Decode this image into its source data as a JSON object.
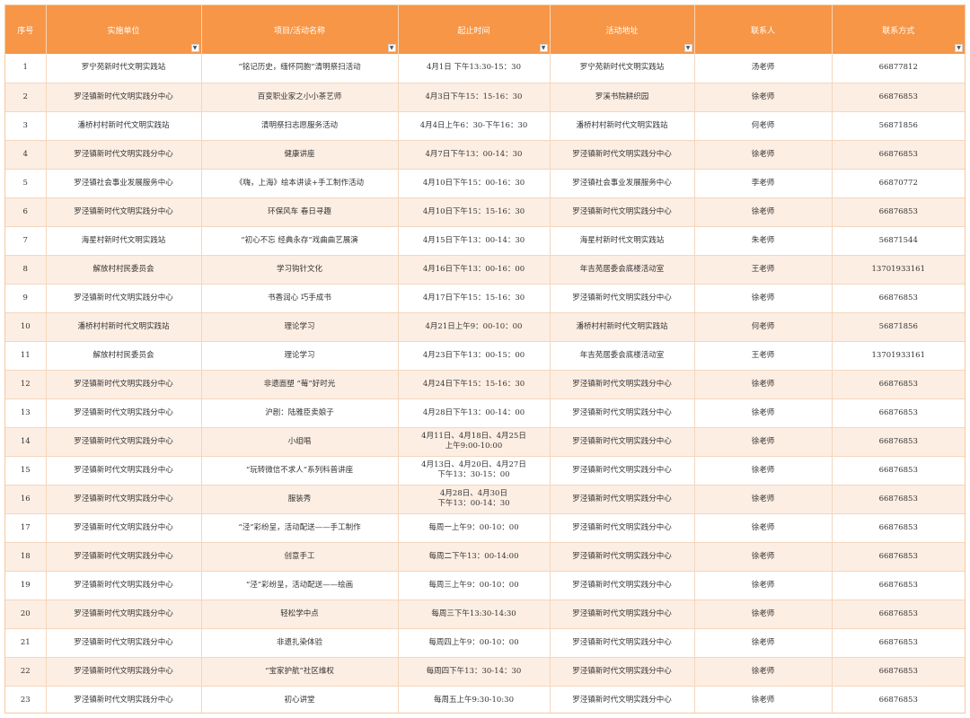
{
  "headers": [
    {
      "key": "no",
      "label": "序号"
    },
    {
      "key": "unit",
      "label": "实施单位"
    },
    {
      "key": "name",
      "label": "项目/活动名称"
    },
    {
      "key": "time",
      "label": "起止时间"
    },
    {
      "key": "place",
      "label": "活动地址"
    },
    {
      "key": "contact",
      "label": "联系人"
    },
    {
      "key": "phone",
      "label": "联系方式"
    }
  ],
  "filter_icon": "dropdown-arrow-icon",
  "colors": {
    "header_bg": "#f79646",
    "header_text": "#ffffff",
    "row_alt_bg": "#fdeee3",
    "row_bg": "#ffffff",
    "border": "#f4d6bd"
  },
  "rows": [
    {
      "no": "1",
      "unit": "罗宁苑新时代文明实践站",
      "name": "“铭记历史，缅怀同胞”清明祭扫活动",
      "time": "4月1日 下午13:30-15：30",
      "place": "罗宁苑新时代文明实践站",
      "contact": "汤老师",
      "phone": "66877812"
    },
    {
      "no": "2",
      "unit": "罗泾镇新时代文明实践分中心",
      "name": "百变职业家之小小茶艺师",
      "time": "4月3日下午15：15-16：30",
      "place": "罗溪书院耕织园",
      "contact": "徐老师",
      "phone": "66876853"
    },
    {
      "no": "3",
      "unit": "潘桥村村新时代文明实践站",
      "name": "清明祭扫志愿服务活动",
      "time": "4月4日上午6：30-下午16：30",
      "place": "潘桥村村新时代文明实践站",
      "contact": "何老师",
      "phone": "56871856"
    },
    {
      "no": "4",
      "unit": "罗泾镇新时代文明实践分中心",
      "name": "健康讲座",
      "time": "4月7日下午13：00-14：30",
      "place": "罗泾镇新时代文明实践分中心",
      "contact": "徐老师",
      "phone": "66876853"
    },
    {
      "no": "5",
      "unit": "罗泾镇社会事业发展服务中心",
      "name": "《嗨，上海》绘本讲读+手工制作活动",
      "time": "4月10日下午15：00-16：30",
      "place": "罗泾镇社会事业发展服务中心",
      "contact": "李老师",
      "phone": "66870772"
    },
    {
      "no": "6",
      "unit": "罗泾镇新时代文明实践分中心",
      "name": "环保风车 春日寻趣",
      "time": "4月10日下午15：15-16：30",
      "place": "罗泾镇新时代文明实践分中心",
      "contact": "徐老师",
      "phone": "66876853"
    },
    {
      "no": "7",
      "unit": "海星村新时代文明实践站",
      "name": "“初心不忘 经典永存”戏曲曲艺展演",
      "time": "4月15日下午13：00-14：30",
      "place": "海星村新时代文明实践站",
      "contact": "朱老师",
      "phone": "56871544"
    },
    {
      "no": "8",
      "unit": "解放村村民委员会",
      "name": "学习钩针文化",
      "time": "4月16日下午13：00-16：00",
      "place": "年吉苑居委会底楼活动室",
      "contact": "王老师",
      "phone": "13701933161"
    },
    {
      "no": "9",
      "unit": "罗泾镇新时代文明实践分中心",
      "name": "书香润心 巧手成书",
      "time": "4月17日下午15：15-16：30",
      "place": "罗泾镇新时代文明实践分中心",
      "contact": "徐老师",
      "phone": "66876853"
    },
    {
      "no": "10",
      "unit": "潘桥村村新时代文明实践站",
      "name": "理论学习",
      "time": "4月21日上午9：00-10：00",
      "place": "潘桥村村新时代文明实践站",
      "contact": "何老师",
      "phone": "56871856"
    },
    {
      "no": "11",
      "unit": "解放村村民委员会",
      "name": "理论学习",
      "time": "4月23日下午13：00-15：00",
      "place": "年吉苑居委会底楼活动室",
      "contact": "王老师",
      "phone": "13701933161"
    },
    {
      "no": "12",
      "unit": "罗泾镇新时代文明实践分中心",
      "name": "非遗面塑 “莓”好时光",
      "time": "4月24日下午15：15-16：30",
      "place": "罗泾镇新时代文明实践分中心",
      "contact": "徐老师",
      "phone": "66876853"
    },
    {
      "no": "13",
      "unit": "罗泾镇新时代文明实践分中心",
      "name": "沪剧：陆雅臣卖娘子",
      "time": "4月28日下午13：00-14：00",
      "place": "罗泾镇新时代文明实践分中心",
      "contact": "徐老师",
      "phone": "66876853"
    },
    {
      "no": "14",
      "unit": "罗泾镇新时代文明实践分中心",
      "name": "小组唱",
      "time": "4月11日、4月18日、4月25日\n上午9:00-10:00",
      "place": "罗泾镇新时代文明实践分中心",
      "contact": "徐老师",
      "phone": "66876853"
    },
    {
      "no": "15",
      "unit": "罗泾镇新时代文明实践分中心",
      "name": "“玩转微信不求人”系列科普讲座",
      "time": "4月13日、4月20日、4月27日\n下午13：30-15：00",
      "place": "罗泾镇新时代文明实践分中心",
      "contact": "徐老师",
      "phone": "66876853"
    },
    {
      "no": "16",
      "unit": "罗泾镇新时代文明实践分中心",
      "name": "服装秀",
      "time": "4月28日、4月30日\n下午13：00-14：30",
      "place": "罗泾镇新时代文明实践分中心",
      "contact": "徐老师",
      "phone": "66876853"
    },
    {
      "no": "17",
      "unit": "罗泾镇新时代文明实践分中心",
      "name": "“泾”彩纷呈，活动配送——手工制作",
      "time": "每周一上午9：00-10：00",
      "place": "罗泾镇新时代文明实践分中心",
      "contact": "徐老师",
      "phone": "66876853"
    },
    {
      "no": "18",
      "unit": "罗泾镇新时代文明实践分中心",
      "name": "创意手工",
      "time": "每周二下午13：00-14:00",
      "place": "罗泾镇新时代文明实践分中心",
      "contact": "徐老师",
      "phone": "66876853"
    },
    {
      "no": "19",
      "unit": "罗泾镇新时代文明实践分中心",
      "name": "“泾”彩纷呈，活动配送——绘画",
      "time": "每周三上午9：00-10：00",
      "place": "罗泾镇新时代文明实践分中心",
      "contact": "徐老师",
      "phone": "66876853"
    },
    {
      "no": "20",
      "unit": "罗泾镇新时代文明实践分中心",
      "name": "轻松学中点",
      "time": "每周三下午13:30-14:30",
      "place": "罗泾镇新时代文明实践分中心",
      "contact": "徐老师",
      "phone": "66876853"
    },
    {
      "no": "21",
      "unit": "罗泾镇新时代文明实践分中心",
      "name": "非遗扎染体验",
      "time": "每周四上午9：00-10：00",
      "place": "罗泾镇新时代文明实践分中心",
      "contact": "徐老师",
      "phone": "66876853"
    },
    {
      "no": "22",
      "unit": "罗泾镇新时代文明实践分中心",
      "name": "“宝家护航”社区维权",
      "time": "每周四下午13：30-14：30",
      "place": "罗泾镇新时代文明实践分中心",
      "contact": "徐老师",
      "phone": "66876853"
    },
    {
      "no": "23",
      "unit": "罗泾镇新时代文明实践分中心",
      "name": "初心讲堂",
      "time": "每周五上午9:30-10:30",
      "place": "罗泾镇新时代文明实践分中心",
      "contact": "徐老师",
      "phone": "66876853"
    }
  ]
}
